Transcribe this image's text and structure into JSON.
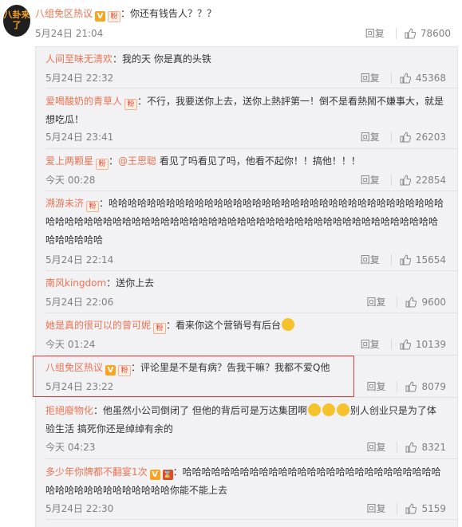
{
  "main_comment": {
    "avatar_text": "八卦来了",
    "author": "八组免区热议",
    "text": "：你还有钱告人？？？",
    "time": "5月24日 21:04",
    "reply_label": "回复",
    "likes": "78600"
  },
  "replies": [
    {
      "author": "人间至味无清欢",
      "text": "：我的天   你是真的头铁",
      "time": "5月24日 22:32",
      "reply_label": "回复",
      "likes": "45368"
    },
    {
      "author": "爱喝酸奶的青草人",
      "text": "：不行，我要送你上去，送你上熱評第一！倒不是看熱鬧不嫌事大，就是想吃瓜！",
      "time": "5月24日 23:41",
      "reply_label": "回复",
      "likes": "26203"
    },
    {
      "author": "爱上两颗星",
      "mention": "@王思聪",
      "text": " 看见了吗看见了吗，他看不起你！！搞他！！！",
      "time": "今天 00:28",
      "reply_label": "回复",
      "likes": "22854"
    },
    {
      "author": "溯游未济",
      "text": "：哈哈哈哈哈哈哈哈哈哈哈哈哈哈哈哈哈哈哈哈哈哈哈哈哈哈哈哈哈哈哈哈哈哈哈哈哈哈哈哈哈哈哈哈哈哈哈哈哈哈哈哈哈哈哈哈哈哈哈哈哈哈哈哈哈哈哈哈哈哈哈哈哈哈哈哈哈哈哈哈哈哈",
      "time": "5月24日 22:14",
      "reply_label": "回复",
      "likes": "15654"
    },
    {
      "author": "南风kingdom",
      "text": "：送你上去",
      "time": "5月24日 22:06",
      "reply_label": "回复",
      "likes": "9600"
    },
    {
      "author": "她是真的很可以的曾可妮",
      "text": "：看来你这个营销号有后台",
      "time": "今天 01:24",
      "reply_label": "回复",
      "likes": "10139"
    },
    {
      "author": "八组免区热议",
      "text": "：评论里是不是有病？告我干嘛？我都不爱Q他",
      "time": "5月24日 23:22",
      "reply_label": "回复",
      "likes": "8079"
    },
    {
      "author": "拒絕廢物化",
      "text": "：他虽然小公司倒闭了 但他的背后可是万达集团啊",
      "text2": "别人创业只是为了体验生活 搞死你还是绰绰有余的",
      "time": "今天 04:23",
      "reply_label": "回复",
      "likes": "8321"
    },
    {
      "author": "多少年你牌都不翻宴1次",
      "text": "：哈哈哈哈哈哈哈哈哈哈哈哈哈哈哈哈哈哈哈哈哈哈哈哈哈哈哈哈哈哈哈哈哈哈哈哈哈哈哈哈你能不能上去",
      "time": "5月24日 22:30",
      "reply_label": "回复",
      "likes": "5159"
    }
  ],
  "colors": {
    "name": "#eb7350",
    "highlight_border": "#e8393a",
    "box_bg": "#f2f2f5"
  },
  "icons": {
    "like": "thumb-up-icon",
    "verified": "v-badge-icon",
    "fan": "fan-badge-icon",
    "emoji": "laugh-cry-emoji"
  }
}
